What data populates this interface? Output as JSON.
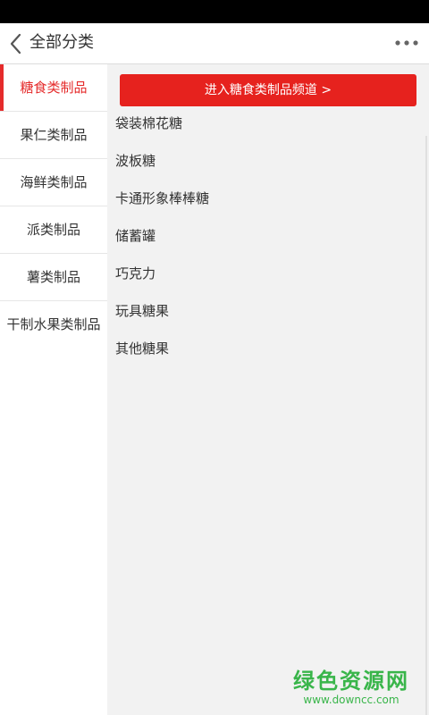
{
  "header": {
    "title": "全部分类",
    "back_icon": "chevron-left-icon",
    "more_icon": "more-dots-icon"
  },
  "sidebar": {
    "items": [
      {
        "label": "糖食类制品",
        "active": true
      },
      {
        "label": "果仁类制品",
        "active": false
      },
      {
        "label": "海鲜类制品",
        "active": false
      },
      {
        "label": "派类制品",
        "active": false
      },
      {
        "label": "薯类制品",
        "active": false
      },
      {
        "label": "干制水果类制品",
        "active": false
      }
    ]
  },
  "content": {
    "channel_button": "进入糖食类制品频道 >",
    "items": [
      "袋装棉花糖",
      "波板糖",
      "卡通形象棒棒糖",
      "储蓄罐",
      "巧克力",
      "玩具糖果",
      "其他糖果"
    ]
  },
  "watermark": {
    "title": "绿色资源网",
    "url": "www.downcc.com"
  },
  "colors": {
    "accent": "#e52b2b",
    "button": "#e6221e",
    "content_bg": "#f2f2f2",
    "watermark": "#39b54a"
  }
}
